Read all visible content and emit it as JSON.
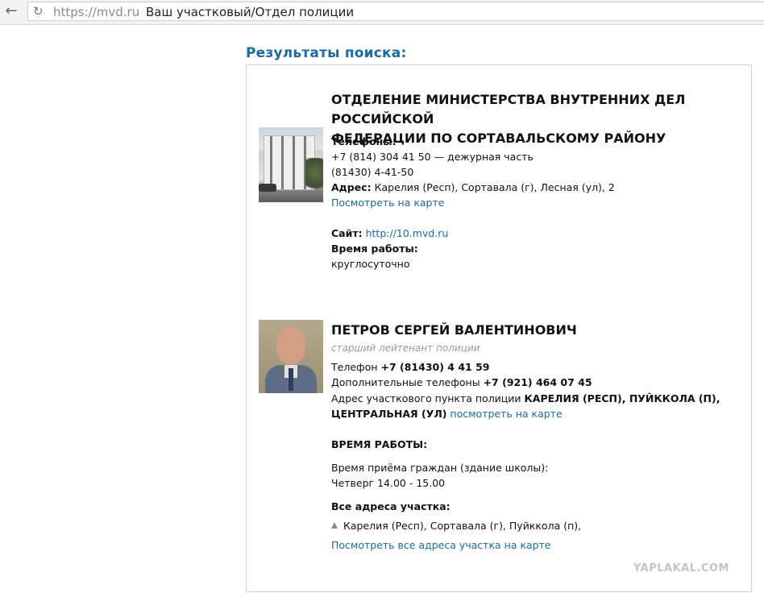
{
  "browser": {
    "back_icon": "arrow-left-icon",
    "reload_icon": "reload-icon",
    "url": "https://mvd.ru",
    "page_title": "Ваш участковый/Отдел полиции"
  },
  "results": {
    "heading": "Результаты поиска:",
    "department": {
      "title_line1": "ОТДЕЛЕНИЕ МИНИСТЕРСТВА ВНУТРЕННИХ ДЕЛ РОССИЙСКОЙ",
      "title_line2": "ФЕДЕРАЦИИ ПО СОРТАВАЛЬСКОМУ РАЙОНУ",
      "phones_label": "Телефоны:",
      "phone1": "+7 (814) 304 41 50 — дежурная часть",
      "phone2": "(81430) 4-41-50",
      "address_label": "Адрес:",
      "address": "Карелия (Респ), Сортавала (г), Лесная (ул), 2",
      "map_link": "Посмотреть на карте",
      "site_label": "Сайт:",
      "site_url": "http://10.mvd.ru",
      "hours_label": "Время работы:",
      "hours": "круглосуточно"
    },
    "officer": {
      "name": "ПЕТРОВ СЕРГЕЙ ВАЛЕНТИНОВИЧ",
      "rank": "старший лейтенант полиции",
      "phone_label": "Телефон",
      "phone": "+7 (81430) 4 41 59",
      "extra_phones_label": "Дополнительные телефоны",
      "extra_phone": "+7 (921) 464 07 45",
      "address_label": "Адрес участкового пункта полиции",
      "address_part1": "КАРЕЛИЯ (РЕСП), ПУЙККОЛА (П),",
      "address_part2": "ЦЕНТРАЛЬНАЯ (УЛ)",
      "map_link": "посмотреть на карте",
      "hours_heading": "ВРЕМЯ РАБОТЫ:",
      "reception_label": "Время приёма граждан (здание школы):",
      "reception_time": "Четверг 14.00 - 15.00",
      "all_addresses_label": "Все адреса участка:",
      "area_address": "Карелия (Респ), Сортавала (г), Пуйккола (п),",
      "all_addresses_link": "Посмотреть все адреса участка на карте"
    }
  },
  "watermark": "YAPLAKAL.COM",
  "colors": {
    "link": "#1a6aa0",
    "heading": "#1a6aa0",
    "rank": "#9a9a9a"
  }
}
